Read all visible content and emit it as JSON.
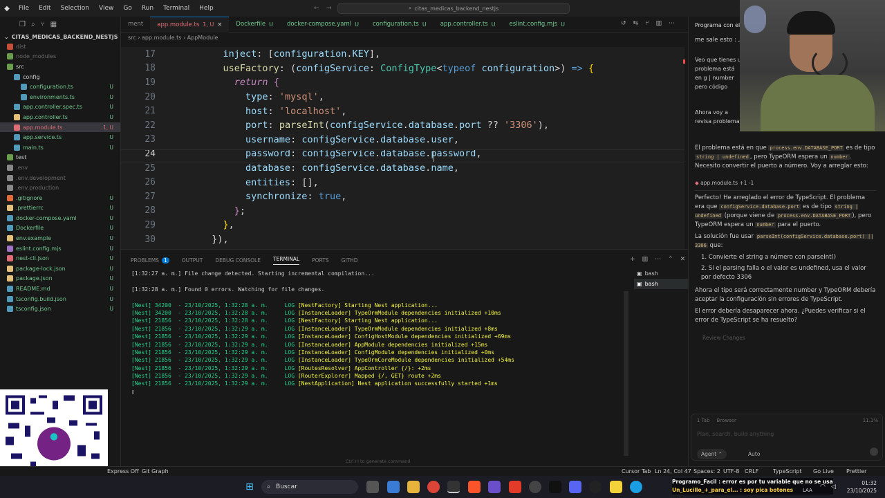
{
  "titlebar": {
    "menus": [
      "File",
      "Edit",
      "Selection",
      "View",
      "Go",
      "Run",
      "Terminal",
      "Help"
    ],
    "search": "citas_medicas_backend_nestjs"
  },
  "explorer": {
    "title": "CITAS_MEDICAS_BACKEND_NESTJS",
    "items": [
      {
        "label": "dist",
        "indent": 1,
        "color": "#c74e39",
        "status": "",
        "dim": true
      },
      {
        "label": "node_modules",
        "indent": 1,
        "color": "#6b9e4c",
        "status": "",
        "dim": true
      },
      {
        "label": "src",
        "indent": 1,
        "color": "#6b9e4c",
        "status": "",
        "dim": false
      },
      {
        "label": "config",
        "indent": 2,
        "color": "#519aba",
        "status": "",
        "dim": false
      },
      {
        "label": "configuration.ts",
        "indent": 3,
        "color": "#519aba",
        "status": "U",
        "dim": false
      },
      {
        "label": "environments.ts",
        "indent": 3,
        "color": "#519aba",
        "status": "U",
        "dim": false
      },
      {
        "label": "app.controller.spec.ts",
        "indent": 2,
        "color": "#519aba",
        "status": "U",
        "dim": false
      },
      {
        "label": "app.controller.ts",
        "indent": 2,
        "color": "#e5c07b",
        "status": "U",
        "dim": false
      },
      {
        "label": "app.module.ts",
        "indent": 2,
        "color": "#e06c75",
        "status": "1, U",
        "dim": false
      },
      {
        "label": "app.service.ts",
        "indent": 2,
        "color": "#519aba",
        "status": "U",
        "dim": false
      },
      {
        "label": "main.ts",
        "indent": 2,
        "color": "#519aba",
        "status": "U",
        "dim": false
      },
      {
        "label": "test",
        "indent": 1,
        "color": "#6b9e4c",
        "status": "",
        "dim": false
      },
      {
        "label": ".env",
        "indent": 1,
        "color": "#888888",
        "status": "",
        "dim": true
      },
      {
        "label": ".env.development",
        "indent": 1,
        "color": "#888888",
        "status": "",
        "dim": true
      },
      {
        "label": ".env.production",
        "indent": 1,
        "color": "#888888",
        "status": "",
        "dim": true
      },
      {
        "label": ".gitignore",
        "indent": 1,
        "color": "#e06c3c",
        "status": "U",
        "dim": false
      },
      {
        "label": ".prettierrc",
        "indent": 1,
        "color": "#e5c07b",
        "status": "U",
        "dim": false
      },
      {
        "label": "docker-compose.yaml",
        "indent": 1,
        "color": "#519aba",
        "status": "U",
        "dim": false
      },
      {
        "label": "Dockerfile",
        "indent": 1,
        "color": "#519aba",
        "status": "U",
        "dim": false
      },
      {
        "label": "env.example",
        "indent": 1,
        "color": "#e5c07b",
        "status": "U",
        "dim": false
      },
      {
        "label": "eslint.config.mjs",
        "indent": 1,
        "color": "#a074c4",
        "status": "U",
        "dim": false
      },
      {
        "label": "nest-cli.json",
        "indent": 1,
        "color": "#e06c75",
        "status": "U",
        "dim": false
      },
      {
        "label": "package-lock.json",
        "indent": 1,
        "color": "#e5c07b",
        "status": "U",
        "dim": false
      },
      {
        "label": "package.json",
        "indent": 1,
        "color": "#e5c07b",
        "status": "U",
        "dim": false
      },
      {
        "label": "README.md",
        "indent": 1,
        "color": "#519aba",
        "status": "U",
        "dim": false
      },
      {
        "label": "tsconfig.build.json",
        "indent": 1,
        "color": "#519aba",
        "status": "U",
        "dim": false
      },
      {
        "label": "tsconfig.json",
        "indent": 1,
        "color": "#519aba",
        "status": "U",
        "dim": false
      }
    ]
  },
  "tabs": [
    {
      "label": "ment",
      "status": "",
      "active": false
    },
    {
      "label": "app.module.ts",
      "status": "1, U",
      "active": true
    },
    {
      "label": "Dockerfile",
      "status": "U",
      "active": false
    },
    {
      "label": "docker-compose.yaml",
      "status": "U",
      "active": false
    },
    {
      "label": "configuration.ts",
      "status": "U",
      "active": false
    },
    {
      "label": "app.controller.ts",
      "status": "U",
      "active": false
    },
    {
      "label": "eslint.config.mjs",
      "status": "U",
      "active": false
    }
  ],
  "breadcrumb": "src  ›  app.module.ts  ›  AppModule",
  "code": [
    {
      "n": "17",
      "html": "    <span class=\"v\">inject</span>: [<span class=\"v\">configuration</span>.<span class=\"v\">KEY</span>],"
    },
    {
      "n": "18",
      "html": "    <span class=\"f\">useFactory</span>: (<span class=\"v\">configService</span>: <span class=\"t\">ConfigType</span>&lt;<span class=\"b\">typeof</span> <span class=\"v\">configuration</span>&gt;) <span class=\"b\">=&gt;</span> <span class=\"y\">{</span>"
    },
    {
      "n": "19",
      "html": "      <span class=\"k\"><i>return</i></span> <span class=\"k\">{</span>"
    },
    {
      "n": "20",
      "html": "        <span class=\"v\">type</span>: <span class=\"s\">'mysql'</span>,"
    },
    {
      "n": "21",
      "html": "        <span class=\"v\">host</span>: <span class=\"s\">'localhost'</span>,"
    },
    {
      "n": "22",
      "html": "        <span class=\"v\">port</span>: <span class=\"f\">parseInt</span>(<span class=\"v\">configService</span>.<span class=\"v\">database</span>.<span class=\"v\">port</span> ?? <span class=\"s\">'3306'</span>),"
    },
    {
      "n": "23",
      "html": "        <span class=\"v\">username</span>: <span class=\"v\">configService</span>.<span class=\"v\">database</span>.<span class=\"v\">user</span>,"
    },
    {
      "n": "24",
      "html": "        <span class=\"v\">password</span>: <span class=\"v\">configService</span>.<span class=\"v\">database</span>.<span class=\"v\">password</span>,"
    },
    {
      "n": "25",
      "html": "        <span class=\"v\">database</span>: <span class=\"v\">configService</span>.<span class=\"v\">database</span>.<span class=\"v\">name</span>,"
    },
    {
      "n": "26",
      "html": "        <span class=\"v\">entities</span>: [],"
    },
    {
      "n": "27",
      "html": "        <span class=\"v\">synchronize</span>: <span class=\"b\">true</span>,"
    },
    {
      "n": "28",
      "html": "      <span class=\"k\">}</span>;"
    },
    {
      "n": "29",
      "html": "    <span class=\"y\">}</span>,"
    },
    {
      "n": "30",
      "html": "  }),"
    }
  ],
  "panel": {
    "tabs": [
      "Problems",
      "Output",
      "Debug Console",
      "Terminal",
      "Ports",
      "GitHD"
    ],
    "problems_count": "1",
    "active": "Terminal",
    "shells": [
      "bash",
      "bash"
    ]
  },
  "terminal": [
    {
      "p": "[1:32:27 a. m.] ",
      "r": "File change detected. Starting incremental compilation...",
      "g": false
    },
    {
      "p": "",
      "r": "",
      "g": false
    },
    {
      "p": "[1:32:28 a. m.] ",
      "r": "Found 0 errors. Watching for file changes.",
      "g": false
    },
    {
      "p": "",
      "r": "",
      "g": false
    },
    {
      "p": "[Nest] 34200  - 23/10/2025, 1:32:28 a. m.     LOG ",
      "r": "[NestFactory] Starting Nest application...",
      "g": true
    },
    {
      "p": "[Nest] 34200  - 23/10/2025, 1:32:28 a. m.     LOG ",
      "r": "[InstanceLoader] TypeOrmModule dependencies initialized +10ms",
      "g": true
    },
    {
      "p": "[Nest] 21856  - 23/10/2025, 1:32:28 a. m.     LOG ",
      "r": "[NestFactory] Starting Nest application...",
      "g": true
    },
    {
      "p": "[Nest] 21856  - 23/10/2025, 1:32:29 a. m.     LOG ",
      "r": "[InstanceLoader] TypeOrmModule dependencies initialized +8ms",
      "g": true
    },
    {
      "p": "[Nest] 21856  - 23/10/2025, 1:32:29 a. m.     LOG ",
      "r": "[InstanceLoader] ConfigHostModule dependencies initialized +69ms",
      "g": true
    },
    {
      "p": "[Nest] 21856  - 23/10/2025, 1:32:29 a. m.     LOG ",
      "r": "[InstanceLoader] AppModule dependencies initialized +15ms",
      "g": true
    },
    {
      "p": "[Nest] 21856  - 23/10/2025, 1:32:29 a. m.     LOG ",
      "r": "[InstanceLoader] ConfigModule dependencies initialized +0ms",
      "g": true
    },
    {
      "p": "[Nest] 21856  - 23/10/2025, 1:32:29 a. m.     LOG ",
      "r": "[InstanceLoader] TypeOrmCoreModule dependencies initialized +54ms",
      "g": true
    },
    {
      "p": "[Nest] 21856  - 23/10/2025, 1:32:29 a. m.     LOG ",
      "r": "[RoutesResolver] AppController {/}: +2ms",
      "g": true
    },
    {
      "p": "[Nest] 21856  - 23/10/2025, 1:32:29 a. m.     LOG ",
      "r": "[RouterExplorer] Mapped {/, GET} route +2ms",
      "g": true
    },
    {
      "p": "[Nest] 21856  - 23/10/2025, 1:32:29 a. m.     LOG ",
      "r": "[NestApplication] Nest application successfully started +1ms",
      "g": true
    }
  ],
  "terminal_hint": "Ctrl+I to generate command",
  "chat": {
    "header": "Programa con el m",
    "p1": "me sale esto : , en",
    "p2": "Veo que tienes u problema está en g | number pero código actual y a",
    "p3": "Ahora voy a revisa problema:",
    "p4": "El problema está en que process.env.DATABASE_PORT es de tipo string | undefined, pero TypeORM espera un number. Necesito convertir el puerto a número. Voy a arreglar esto:",
    "file_chip": "app.module.ts  +1 -1",
    "p5": "Perfecto! He arreglado el error de TypeScript. El problema era que configService.database.port es de tipo string | undefined (porque viene de process.env.DATABASE_PORT), pero TypeORM espera un number para el puerto.",
    "p6": "La solución fue usar parseInt(configService.database.port) || 3306 que:",
    "li1": "1. Convierte el string a número con parseInt()",
    "li2": "2. Si el parsing falla o el valor es undefined, usa el valor por defecto 3306",
    "p7": "Ahora el tipo será correctamente number y TypeORM debería aceptar la configuración sin errores de TypeScript.",
    "p8": "El error debería desaparecer ahora. ¿Puedes verificar si el error de TypeScript se ha resuelto?",
    "review": "Review Changes",
    "tabs_info": "1 Tab",
    "browser": "Browser",
    "pct": "11.1%",
    "placeholder": "Plan, search, build anything",
    "agent": "Agent",
    "auto": "Auto"
  },
  "statusbar": {
    "left1": "Express Off",
    "left2": "Git Graph",
    "cursor_tab": "Cursor Tab",
    "ln": "Ln 24, Col 47",
    "spaces": "Spaces: 2",
    "enc": "UTF-8",
    "eol": "CRLF",
    "lang": "TypeScript",
    "golive": "Go Live",
    "prettier": "Prettier"
  },
  "taskbar": {
    "search": "Buscar",
    "time": "01:32",
    "date": "23/10/2025",
    "lang": "LAA",
    "ticker1": "Programo_Facil : error es por tu variable que no se usa",
    "ticker2": "Un_Lucillo_+_para_el... : soy pica botones"
  }
}
